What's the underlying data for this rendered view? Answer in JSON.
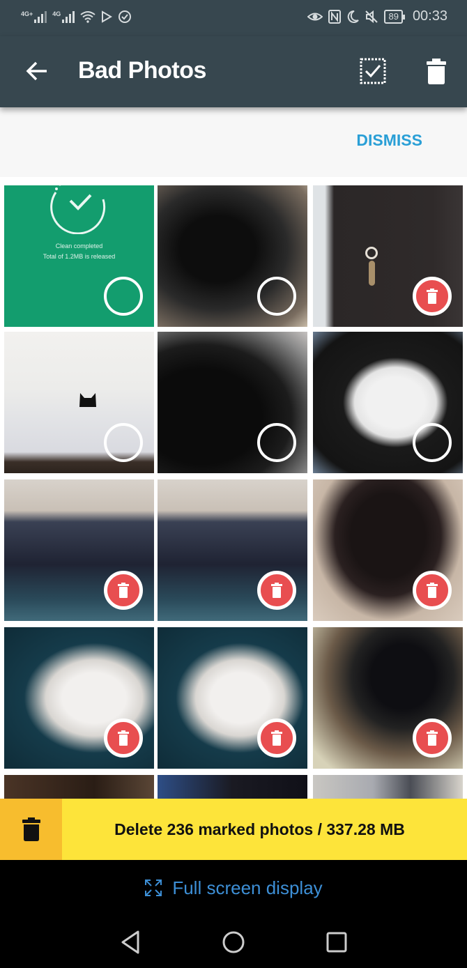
{
  "status_bar": {
    "network_1": "4G+",
    "network_2": "4G",
    "battery": "89",
    "time": "00:33",
    "icons_left": [
      "signal-4g-plus-icon",
      "signal-4g-icon",
      "wifi-icon",
      "play-store-icon",
      "check-circle-icon"
    ],
    "icons_right": [
      "eye-icon",
      "nfc-icon",
      "moon-icon",
      "mute-icon",
      "battery-icon"
    ]
  },
  "app_bar": {
    "title": "Bad Photos",
    "back_icon": "arrow-left-icon",
    "select_all_icon": "select-all-icon",
    "delete_icon": "trash-icon"
  },
  "banner": {
    "dismiss_label": "DISMISS"
  },
  "grid": {
    "clean_card": {
      "line1": "Clean completed",
      "line2": "Total of 1.2MB is released"
    },
    "tiles": [
      {
        "type": "clean-card",
        "marked": false
      },
      {
        "type": "photo",
        "description": "black cat on bed",
        "marked": false
      },
      {
        "type": "photo",
        "description": "black cat with tag",
        "marked": true
      },
      {
        "type": "photo",
        "description": "cat in bathtub",
        "marked": false
      },
      {
        "type": "photo",
        "description": "black cat close-up",
        "marked": false
      },
      {
        "type": "photo",
        "description": "black and white cat sleeping",
        "marked": false
      },
      {
        "type": "photo",
        "description": "cat on lap with blanket",
        "marked": true
      },
      {
        "type": "photo",
        "description": "cat on lap with blanket",
        "marked": true
      },
      {
        "type": "photo",
        "description": "black cat on carpet",
        "marked": true
      },
      {
        "type": "photo",
        "description": "white cat on blanket",
        "marked": true
      },
      {
        "type": "photo",
        "description": "white cat on blanket",
        "marked": true
      },
      {
        "type": "photo",
        "description": "black cat on basket",
        "marked": true
      },
      {
        "type": "photo",
        "description": "partial photo",
        "marked": false
      },
      {
        "type": "photo",
        "description": "partial photo",
        "marked": false
      },
      {
        "type": "photo",
        "description": "partial photo",
        "marked": false
      }
    ]
  },
  "delete_bar": {
    "label": "Delete 236 marked photos / 337.28 MB",
    "count": 236,
    "size": "337.28 MB"
  },
  "fullscreen": {
    "label": "Full screen display"
  },
  "colors": {
    "app_bar": "#37474f",
    "accent": "#2a9fd6",
    "clean_green": "#139d6e",
    "delete_red": "#e84e50",
    "delete_bar": "#fde43a",
    "delete_bar_icon_bg": "#f7bd2e"
  }
}
